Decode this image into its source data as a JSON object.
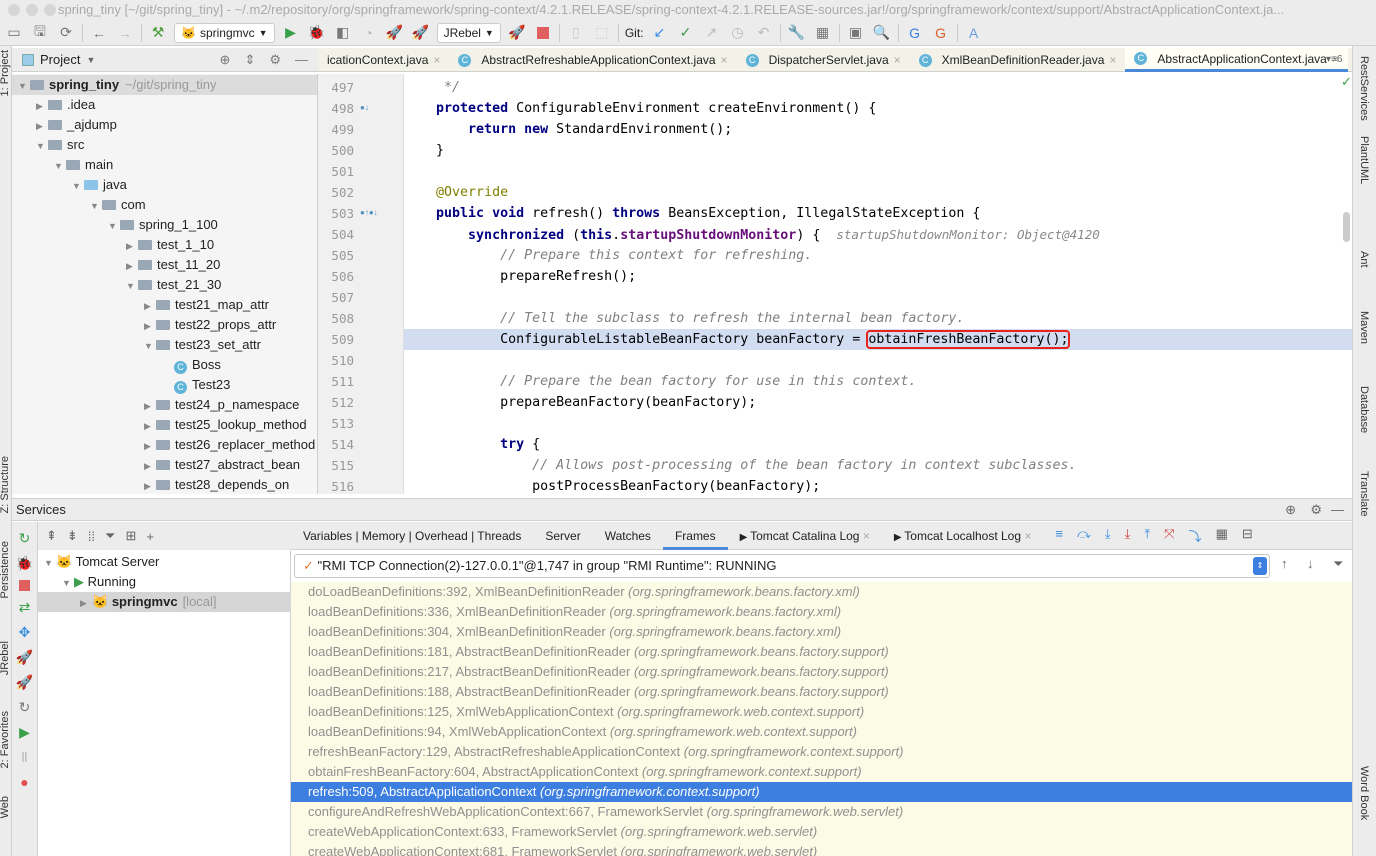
{
  "window": {
    "title": "spring_tiny [~/git/spring_tiny] - ~/.m2/repository/org/springframework/spring-context/4.2.1.RELEASE/spring-context-4.2.1.RELEASE-sources.jar!/org/springframework/context/support/AbstractApplicationContext.ja..."
  },
  "toolbar": {
    "run_config": "springmvc",
    "jrebel": "JRebel",
    "git_label": "Git:"
  },
  "project": {
    "header": "Project",
    "tree": [
      {
        "label": "spring_tiny",
        "extra": "~/git/spring_tiny",
        "depth": 0,
        "open": true,
        "bold": true
      },
      {
        "label": ".idea",
        "depth": 1,
        "open": false
      },
      {
        "label": "_ajdump",
        "depth": 1,
        "open": false
      },
      {
        "label": "src",
        "depth": 1,
        "open": true
      },
      {
        "label": "main",
        "depth": 2,
        "open": true
      },
      {
        "label": "java",
        "depth": 3,
        "open": true,
        "blue": true
      },
      {
        "label": "com",
        "depth": 4,
        "open": true
      },
      {
        "label": "spring_1_100",
        "depth": 5,
        "open": true
      },
      {
        "label": "test_1_10",
        "depth": 6,
        "open": false
      },
      {
        "label": "test_11_20",
        "depth": 6,
        "open": false
      },
      {
        "label": "test_21_30",
        "depth": 6,
        "open": true
      },
      {
        "label": "test21_map_attr",
        "depth": 7,
        "open": false
      },
      {
        "label": "test22_props_attr",
        "depth": 7,
        "open": false
      },
      {
        "label": "test23_set_attr",
        "depth": 7,
        "open": true
      },
      {
        "label": "Boss",
        "depth": 8,
        "cls": true
      },
      {
        "label": "Test23",
        "depth": 8,
        "cls": true
      },
      {
        "label": "test24_p_namespace",
        "depth": 7,
        "open": false
      },
      {
        "label": "test25_lookup_method",
        "depth": 7,
        "open": false
      },
      {
        "label": "test26_replacer_method",
        "depth": 7,
        "open": false
      },
      {
        "label": "test27_abstract_bean",
        "depth": 7,
        "open": false
      },
      {
        "label": "test28_depends_on",
        "depth": 7,
        "open": false
      }
    ]
  },
  "tabs": [
    {
      "label": "icationContext.java",
      "icon": false
    },
    {
      "label": "AbstractRefreshableApplicationContext.java",
      "icon": true
    },
    {
      "label": "DispatcherServlet.java",
      "icon": true
    },
    {
      "label": "XmlBeanDefinitionReader.java",
      "icon": true
    },
    {
      "label": "AbstractApplicationContext.java",
      "icon": true,
      "active": true
    }
  ],
  "tabs_more": "6",
  "editor": {
    "lines": [
      {
        "n": "497",
        "html": "     <span class='cm'>*/</span>"
      },
      {
        "n": "498",
        "html": "    <span class='kw'>protected</span> ConfigurableEnvironment createEnvironment() {"
      },
      {
        "n": "499",
        "html": "        <span class='kw'>return new</span> StandardEnvironment();"
      },
      {
        "n": "500",
        "html": "    }"
      },
      {
        "n": "501",
        "html": ""
      },
      {
        "n": "502",
        "html": "    <span class='an'>@Override</span>"
      },
      {
        "n": "503",
        "html": "    <span class='kw'>public void</span> refresh() <span class='kw'>throws</span> BeansException, IllegalStateException {"
      },
      {
        "n": "504",
        "html": "        <span class='kw'>synchronized</span> (<span class='kw'>this</span>.<span class='fd'>startupShutdownMonitor</span>) {  <span class='hint'>startupShutdownMonitor: Object@4120</span>"
      },
      {
        "n": "505",
        "html": "            <span class='cm'>// Prepare this context for refreshing.</span>"
      },
      {
        "n": "506",
        "html": "            prepareRefresh();"
      },
      {
        "n": "507",
        "html": ""
      },
      {
        "n": "508",
        "html": "            <span class='cm'>// Tell the subclass to refresh the internal bean factory.</span>"
      },
      {
        "n": "509",
        "html": "            ConfigurableListableBeanFactory beanFactory = <span class='box'>obtainFreshBeanFactory();</span>",
        "hl": true
      },
      {
        "n": "510",
        "html": ""
      },
      {
        "n": "511",
        "html": "            <span class='cm'>// Prepare the bean factory for use in this context.</span>"
      },
      {
        "n": "512",
        "html": "            prepareBeanFactory(beanFactory);"
      },
      {
        "n": "513",
        "html": ""
      },
      {
        "n": "514",
        "html": "            <span class='kw'>try</span> {"
      },
      {
        "n": "515",
        "html": "                <span class='cm'>// Allows post-processing of the bean factory in context subclasses.</span>"
      },
      {
        "n": "516",
        "html": "                postProcessBeanFactory(beanFactory);"
      }
    ]
  },
  "right_tools": [
    "RestServices",
    "PlantUML",
    "Ant",
    "Maven",
    "Database",
    "Translate",
    "Word Book"
  ],
  "left_tools": [
    "1: Project",
    "Z: Structure",
    "Persistence",
    "JRebel",
    "2: Favorites",
    "Web"
  ],
  "services": {
    "title": "Services",
    "tree": [
      {
        "label": "Tomcat Server",
        "depth": 0
      },
      {
        "label": "Running",
        "depth": 1
      },
      {
        "label": "springmvc",
        "extra": "[local]",
        "depth": 2,
        "selected": true
      }
    ]
  },
  "debugger": {
    "tabs": [
      "Variables | Memory | Overhead | Threads",
      "Server",
      "Watches",
      "Frames",
      "Tomcat Catalina Log",
      "Tomcat Localhost Log"
    ],
    "active_tab": "Frames",
    "thread": "\"RMI TCP Connection(2)-127.0.0.1\"@1,747 in group \"RMI Runtime\": RUNNING",
    "frames": [
      {
        "m": "doLoadBeanDefinitions:392, XmlBeanDefinitionReader",
        "p": "(org.springframework.beans.factory.xml)"
      },
      {
        "m": "loadBeanDefinitions:336, XmlBeanDefinitionReader",
        "p": "(org.springframework.beans.factory.xml)"
      },
      {
        "m": "loadBeanDefinitions:304, XmlBeanDefinitionReader",
        "p": "(org.springframework.beans.factory.xml)"
      },
      {
        "m": "loadBeanDefinitions:181, AbstractBeanDefinitionReader",
        "p": "(org.springframework.beans.factory.support)"
      },
      {
        "m": "loadBeanDefinitions:217, AbstractBeanDefinitionReader",
        "p": "(org.springframework.beans.factory.support)"
      },
      {
        "m": "loadBeanDefinitions:188, AbstractBeanDefinitionReader",
        "p": "(org.springframework.beans.factory.support)"
      },
      {
        "m": "loadBeanDefinitions:125, XmlWebApplicationContext",
        "p": "(org.springframework.web.context.support)"
      },
      {
        "m": "loadBeanDefinitions:94, XmlWebApplicationContext",
        "p": "(org.springframework.web.context.support)"
      },
      {
        "m": "refreshBeanFactory:129, AbstractRefreshableApplicationContext",
        "p": "(org.springframework.context.support)"
      },
      {
        "m": "obtainFreshBeanFactory:604, AbstractApplicationContext",
        "p": "(org.springframework.context.support)"
      },
      {
        "m": "refresh:509, AbstractApplicationContext",
        "p": "(org.springframework.context.support)",
        "selected": true
      },
      {
        "m": "configureAndRefreshWebApplicationContext:667, FrameworkServlet",
        "p": "(org.springframework.web.servlet)"
      },
      {
        "m": "createWebApplicationContext:633, FrameworkServlet",
        "p": "(org.springframework.web.servlet)"
      },
      {
        "m": "createWebApplicationContext:681, FrameworkServlet",
        "p": "(org.springframework.web.servlet)"
      }
    ]
  },
  "colors": {
    "selection": "#3d7fe0",
    "highlight_line": "#d2ddf2",
    "red_box": "#e8231c",
    "frames_bg": "#fbfbe6"
  }
}
